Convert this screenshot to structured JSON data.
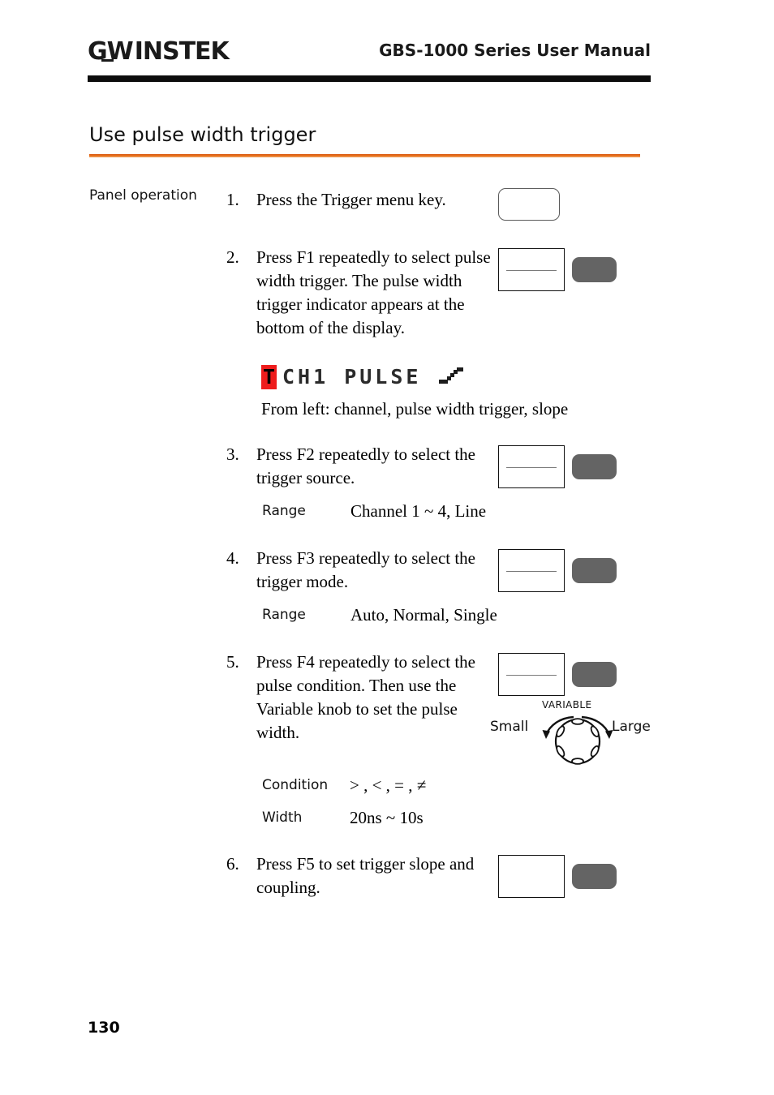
{
  "header": {
    "logo_gw": "G",
    "logo_w": "W",
    "logo_instek": "INSTEK",
    "manual_title": "GBS-1000 Series User Manual"
  },
  "section": {
    "title": "Use pulse width trigger",
    "accent_color": "#e8701b"
  },
  "body": {
    "panel_operation_label": "Panel operation"
  },
  "steps": [
    {
      "num": "1.",
      "text": "Press the Trigger menu key.",
      "key_type": "rounded-key"
    },
    {
      "num": "2.",
      "text": "Press F1 repeatedly to select pulse width trigger. The pulse width trigger indicator appears at the bottom of the display.",
      "key_type": "f-key-with-line"
    },
    {
      "num": "3.",
      "text": "Press F2 repeatedly to select the trigger source.",
      "key_type": "f-key-with-line"
    },
    {
      "num": "4.",
      "text": "Press F3 repeatedly to select the trigger mode.",
      "key_type": "f-key-with-line"
    },
    {
      "num": "5.",
      "text": "Press F4 repeatedly to select the pulse condition. Then use the Variable knob to set the pulse width.",
      "key_type": "f-key-with-line"
    },
    {
      "num": "6.",
      "text": "Press F5 to set trigger slope and coupling.",
      "key_type": "f-key-blank"
    }
  ],
  "lcd_indicator": {
    "trigger_badge": "T",
    "badge_color": "#ee1c1c",
    "channel_and_mode": "CH1 PULSE",
    "slope_icon": "rising-edge-slope-icon",
    "caption": "From left: channel, pulse width trigger, slope"
  },
  "ranges": {
    "source": {
      "key": "Range",
      "value": "Channel 1 ~ 4, Line"
    },
    "mode": {
      "key": "Range",
      "value": "Auto, Normal, Single"
    },
    "condition": {
      "key": "Condition",
      "value": "> , < , = , ≠"
    },
    "width": {
      "key": "Width",
      "value": "20ns ~ 10s"
    }
  },
  "knob": {
    "name": "VARIABLE",
    "left_label": "Small",
    "right_label": "Large"
  },
  "footer": {
    "page_number": "130"
  }
}
